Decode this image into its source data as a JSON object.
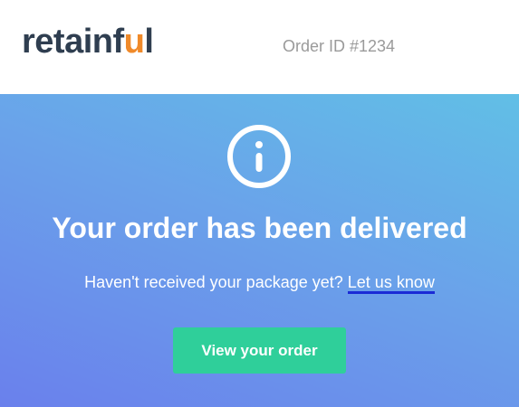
{
  "header": {
    "logo_text_start": "retainf",
    "logo_text_accent": "u",
    "logo_text_end": "l",
    "order_id": "Order ID #1234"
  },
  "hero": {
    "icon": "info-icon",
    "title": "Your order has been delivered",
    "subtitle_text": "Haven't received your package yet?",
    "subtitle_link": "Let us know",
    "cta_label": "View your order"
  },
  "colors": {
    "logo_text": "#2f3e50",
    "logo_accent": "#f08a2a",
    "order_id_text": "#9a9a9a",
    "hero_gradient_start": "#61bfe6",
    "hero_gradient_end": "#6a80ec",
    "link_underline": "#1a2bd6",
    "cta_background": "#2fcf9a",
    "text_on_hero": "#ffffff"
  }
}
